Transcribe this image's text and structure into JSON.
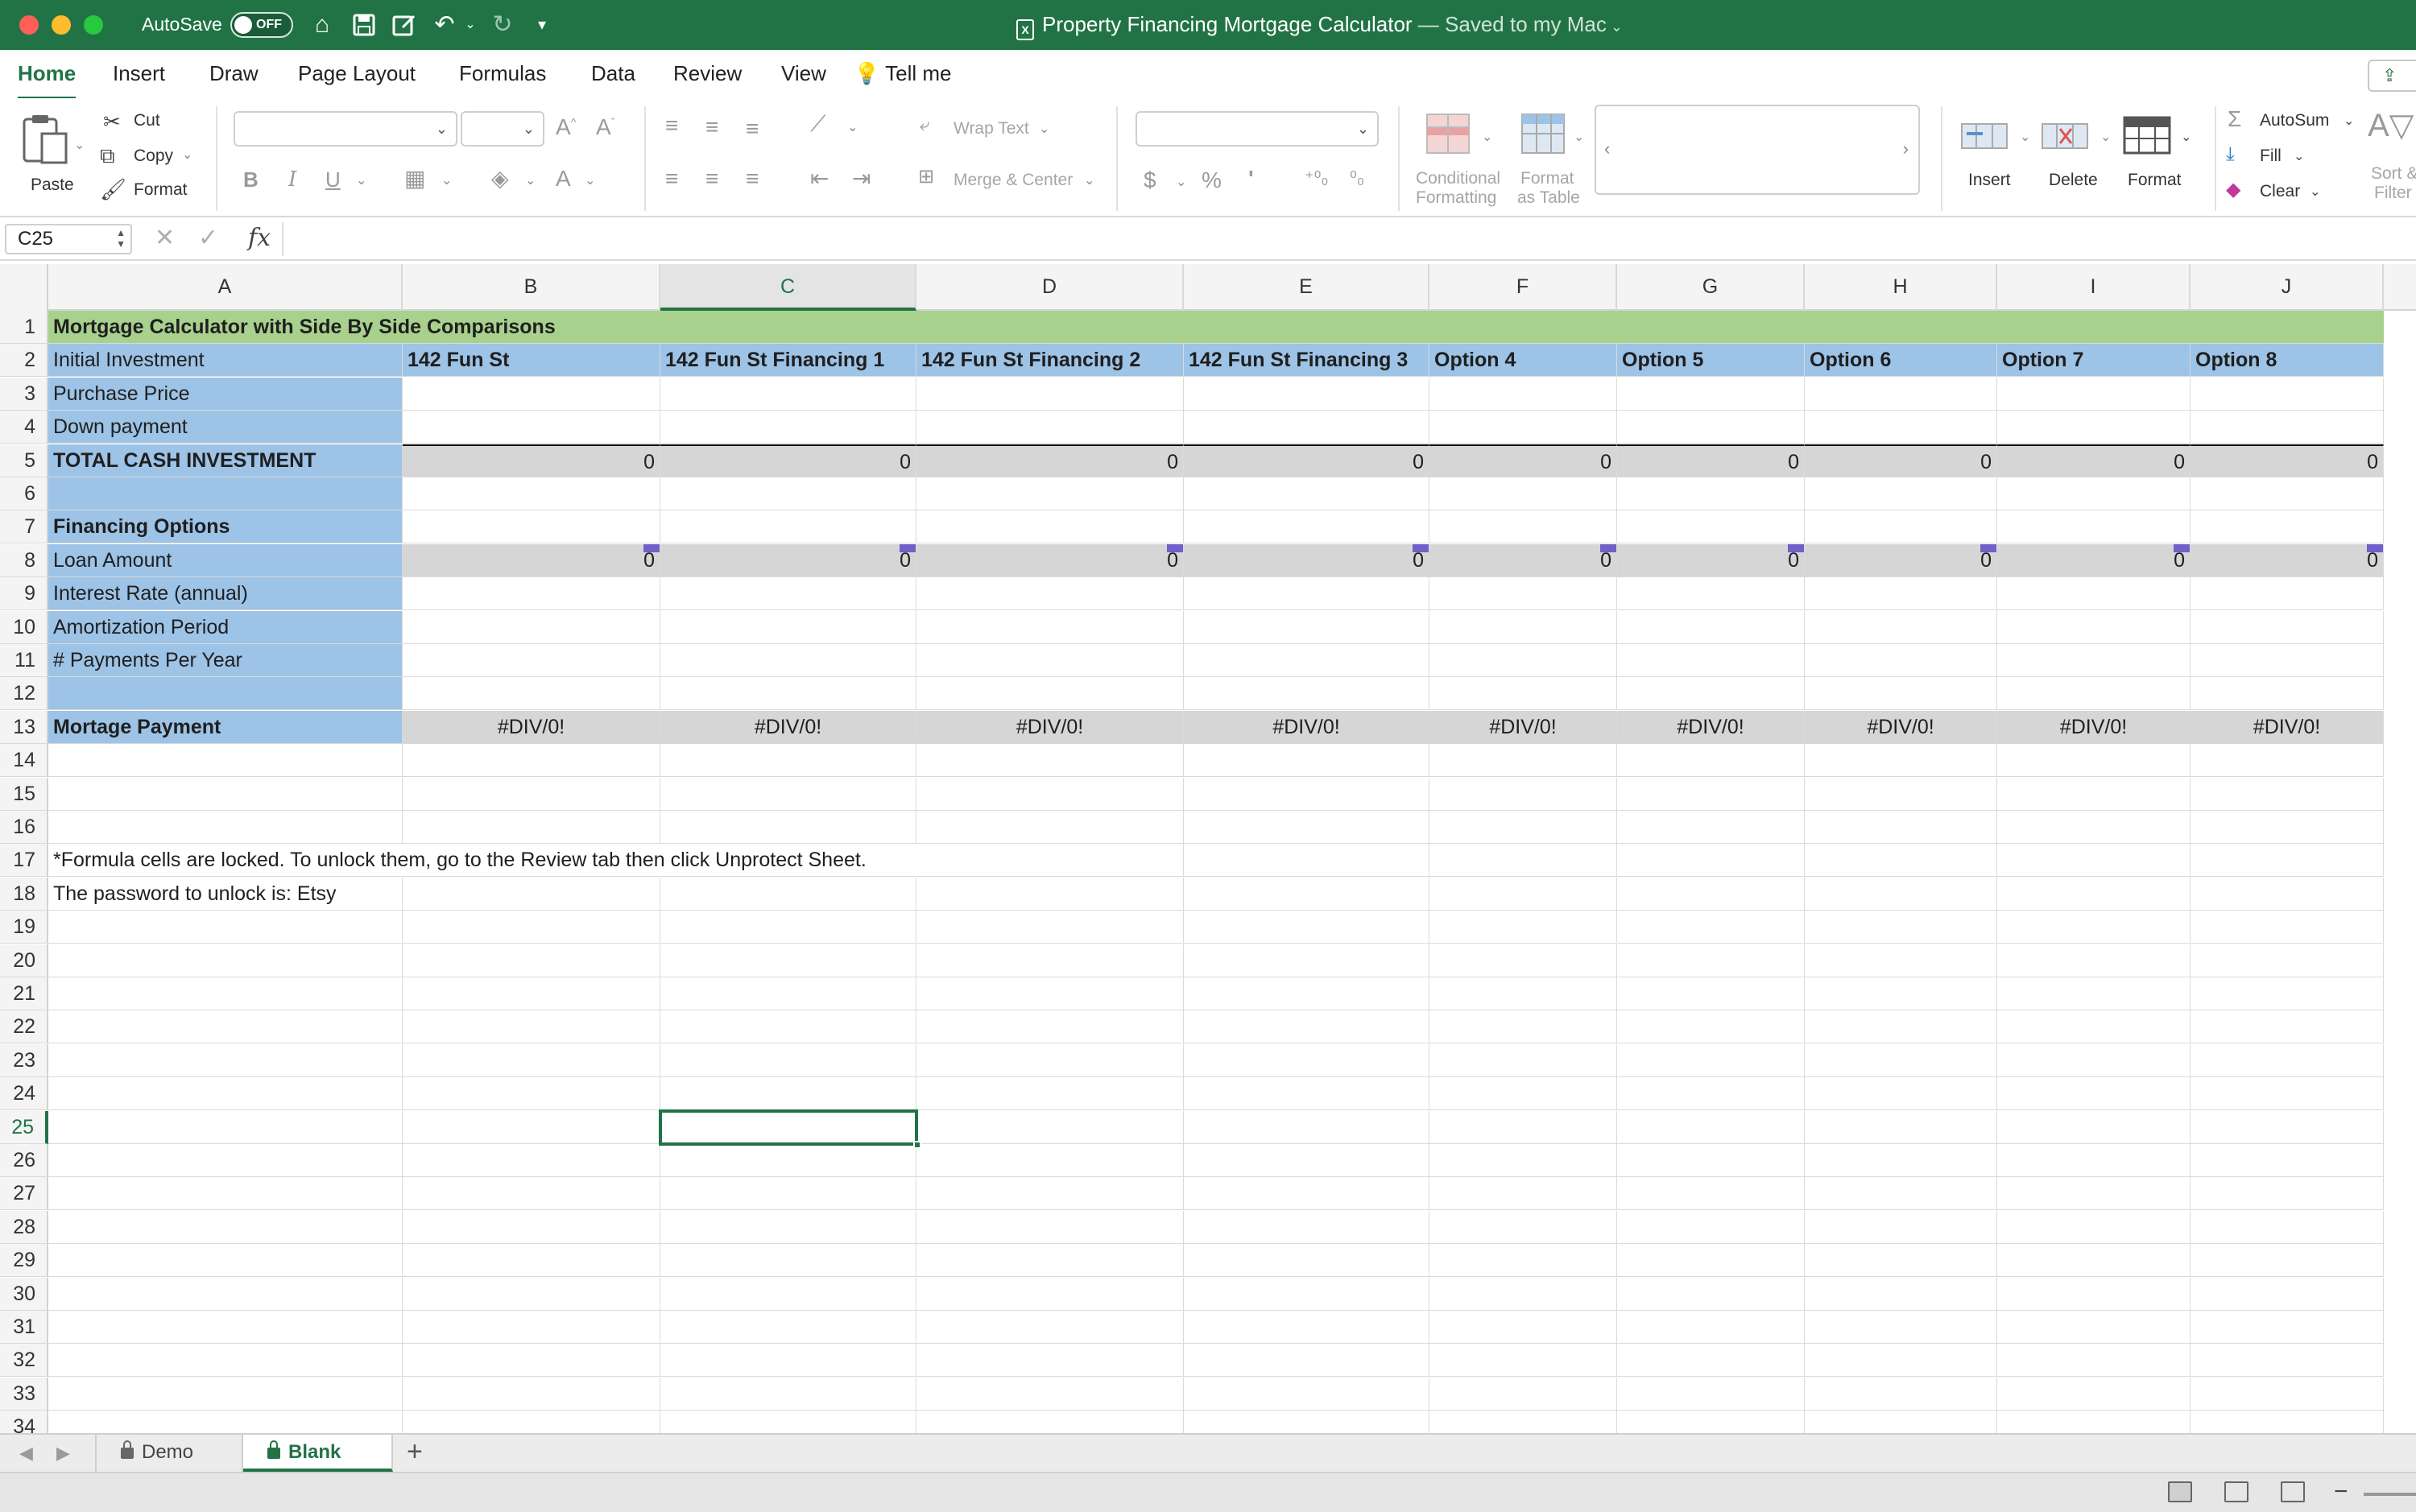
{
  "window": {
    "title": "Property Financing Mortgage Calculator",
    "subtitle": "— Saved to my Mac",
    "autosave_label": "AutoSave",
    "autosave_state": "OFF"
  },
  "ribbon_tabs": [
    "Home",
    "Insert",
    "Draw",
    "Page Layout",
    "Formulas",
    "Data",
    "Review",
    "View",
    "Tell me"
  ],
  "ribbon": {
    "paste": "Paste",
    "cut": "Cut",
    "copy": "Copy",
    "format_painter": "Format",
    "bold": "B",
    "italic": "I",
    "underline": "U",
    "wrap_text": "Wrap Text",
    "merge_center": "Merge & Center",
    "currency": "$",
    "percent": "%",
    "comma": "'",
    "conditional_formatting_1": "Conditional",
    "conditional_formatting_2": "Formatting",
    "format_as_table_1": "Format",
    "format_as_table_2": "as Table",
    "insert": "Insert",
    "delete": "Delete",
    "format": "Format",
    "autosum": "AutoSum",
    "fill": "Fill",
    "clear": "Clear",
    "sort_filter_1": "Sort &",
    "sort_filter_2": "Filter"
  },
  "formula_bar": {
    "name_box": "C25",
    "fx": "fx",
    "formula": ""
  },
  "columns": [
    "A",
    "B",
    "C",
    "D",
    "E",
    "F",
    "G",
    "H",
    "I",
    "J"
  ],
  "selected_column": "C",
  "selected_row": "25",
  "sheet": {
    "title": "Mortgage Calculator with Side By Side Comparisons",
    "row2_label": "Initial Investment",
    "options": [
      "142 Fun St",
      "142 Fun St Financing 1",
      "142 Fun St Financing 2",
      "142 Fun St Financing 3",
      "Option 4",
      "Option 5",
      "Option 6",
      "Option 7",
      "Option 8"
    ],
    "purchase_price": "Purchase Price",
    "down_payment": "Down payment",
    "total_cash_investment": "TOTAL CASH INVESTMENT",
    "total_values": [
      "0",
      "0",
      "0",
      "0",
      "0",
      "0",
      "0",
      "0",
      "0"
    ],
    "financing_options": "Financing Options",
    "loan_amount": "Loan Amount",
    "loan_values": [
      "0",
      "0",
      "0",
      "0",
      "0",
      "0",
      "0",
      "0",
      "0"
    ],
    "interest_rate": "Interest Rate (annual)",
    "amortization_period": "Amortization Period",
    "payments_per_year": "# Payments Per Year",
    "mortgage_payment": "Mortage Payment",
    "mortgage_values": [
      "#DIV/0!",
      "#DIV/0!",
      "#DIV/0!",
      "#DIV/0!",
      "#DIV/0!",
      "#DIV/0!",
      "#DIV/0!",
      "#DIV/0!",
      "#DIV/0!"
    ],
    "note_1": "*Formula cells are locked. To unlock them, go to the Review tab then click Unprotect Sheet.",
    "note_2": "The password to unlock is: Etsy"
  },
  "sheet_tabs": [
    "Demo",
    "Blank"
  ],
  "active_sheet": "Blank",
  "add_sheet": "+",
  "colors": {
    "brand": "#217346",
    "title_fill": "#a9d18e",
    "label_fill": "#9dc3e6",
    "formula_fill": "#d6d6d6",
    "locked_marker": "#6f61c9"
  }
}
